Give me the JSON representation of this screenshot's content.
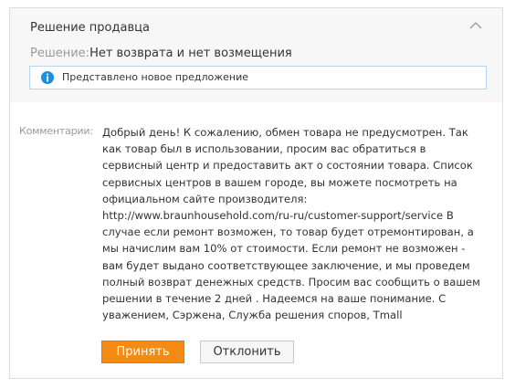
{
  "panel": {
    "title": "Решение продавца",
    "decision_label": "Решение:",
    "decision_value": "Нет возврата и нет возмещения",
    "notice": "Представлено новое предложение"
  },
  "comment": {
    "label": "Комментарии:",
    "lines": [
      "Добрый день! К сожалению, обмен товара не предусмотрен. Так",
      "как товар был в использовании, просим вас обратиться в",
      "сервисный центр и предоставить акт о состоянии товара. Список",
      "сервисных центров в вашем городе, вы можете посмотреть на",
      "официальном сайте производителя:",
      "http://www.braunhousehold.com/ru-ru/customer-support/service В",
      "случае если ремонт возможен, то товар будет отремонтирован, а",
      "мы начислим вам 10% от стоимости. Если ремонт не возможен -",
      "вам будет выдано соответствующее заключение, и мы проведем",
      "полный возврат денежных средств. Просим вас сообщить о вашем",
      "решении в течение 2 дней . Надеемся на ваше понимание. С",
      "уважением, Сэржена, Служба решения споров, Tmall"
    ]
  },
  "buttons": {
    "accept": "Принять",
    "decline": "Отклонить"
  },
  "icons": {
    "collapse": "chevron-up-icon",
    "info": "info-icon"
  },
  "colors": {
    "accent": "#f38b14",
    "info": "#1a8fe3",
    "notice_border": "#b5d5f2",
    "header_bg": "#f7f7f7"
  }
}
